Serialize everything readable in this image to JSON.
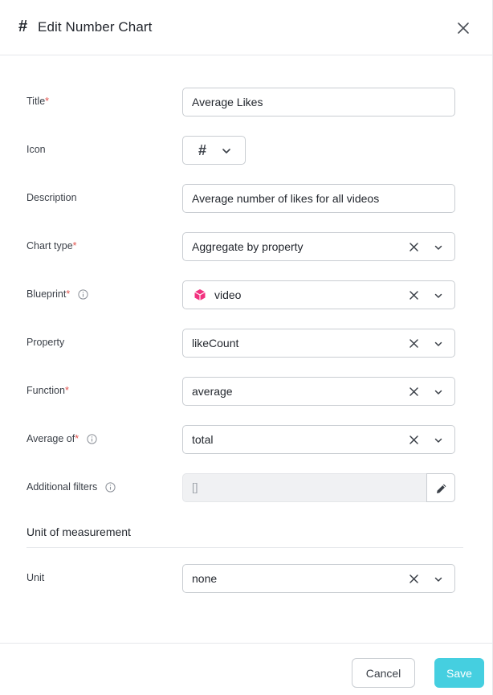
{
  "header": {
    "title": "Edit Number Chart",
    "icon": "hash-icon",
    "close_icon": "close-icon"
  },
  "form": {
    "title": {
      "label": "Title",
      "required": "*",
      "value": "Average Likes"
    },
    "icon": {
      "label": "Icon",
      "value_icon": "hash-icon"
    },
    "description": {
      "label": "Description",
      "value": "Average number of likes for all videos"
    },
    "chart_type": {
      "label": "Chart type",
      "required": "*",
      "value": "Aggregate by property"
    },
    "blueprint": {
      "label": "Blueprint",
      "required": "*",
      "value": "video",
      "value_icon": "cube-icon"
    },
    "property": {
      "label": "Property",
      "value": "likeCount"
    },
    "function": {
      "label": "Function",
      "required": "*",
      "value": "average"
    },
    "average_of": {
      "label": "Average of",
      "required": "*",
      "value": "total"
    },
    "additional_filters": {
      "label": "Additional filters",
      "placeholder": "[]"
    }
  },
  "unit_section": {
    "title": "Unit of measurement",
    "unit": {
      "label": "Unit",
      "value": "none"
    }
  },
  "footer": {
    "cancel_label": "Cancel",
    "save_label": "Save"
  },
  "colors": {
    "accent": "#45cfe0",
    "required": "#e2544f",
    "blueprint_icon": "#f2327f"
  }
}
